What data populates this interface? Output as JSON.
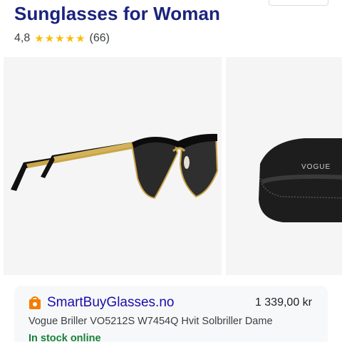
{
  "header": {
    "title": "Sunglasses for Woman"
  },
  "rating": {
    "value": "4,8",
    "stars": 5,
    "count": "(66)",
    "star_color": "#fbbc04"
  },
  "gallery": {
    "images": [
      {
        "icon": "sunglasses-image"
      },
      {
        "icon": "glasses-case-image",
        "brand": "VOGUE"
      }
    ]
  },
  "offer": {
    "merchant": "SmartBuyGlasses.no",
    "price": "1 339,00 kr",
    "product": "Vogue Briller VO5212S W7454Q Hvit Solbriller Dame",
    "stock": "In stock online",
    "merchant_color": "#1a0dab",
    "stock_color": "#188038"
  }
}
